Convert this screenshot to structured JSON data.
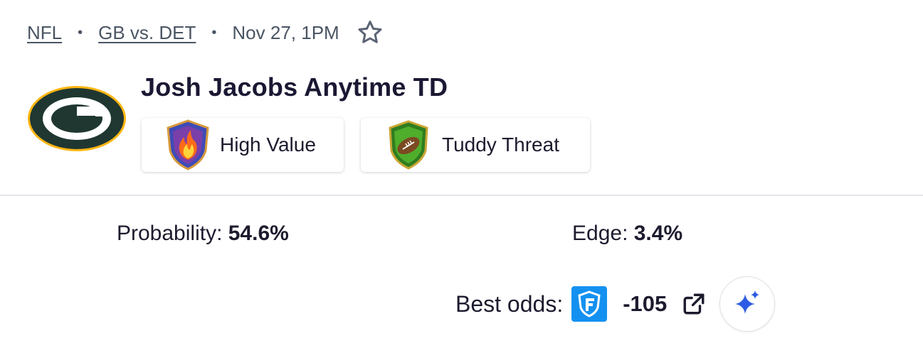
{
  "breadcrumb": {
    "league": "NFL",
    "matchup": "GB vs. DET",
    "datetime": "Nov 27, 1PM",
    "separator": "•"
  },
  "icons": {
    "favorite": "star-outline-icon",
    "team_logo": "green-bay-packers-logo",
    "high_value": "flaming-shield-icon",
    "tuddy_threat": "football-shield-icon",
    "sportsbook": "fanduel-logo",
    "external": "external-link-icon",
    "ai": "sparkle-icon"
  },
  "title": "Josh Jacobs Anytime TD",
  "badges": [
    {
      "label": "High Value"
    },
    {
      "label": "Tuddy Threat"
    }
  ],
  "stats": {
    "probability_label": "Probability:",
    "probability_value": "54.6%",
    "edge_label": "Edge:",
    "edge_value": "3.4%"
  },
  "odds": {
    "label": "Best odds:",
    "value": "-105"
  },
  "colors": {
    "text_primary": "#1a1833",
    "text_muted": "#4a5563",
    "packers_green": "#203731",
    "packers_gold": "#ffb612",
    "fanduel_blue": "#1491f0",
    "ai_blue": "#2d5be3",
    "divider": "#e4e6ea"
  }
}
